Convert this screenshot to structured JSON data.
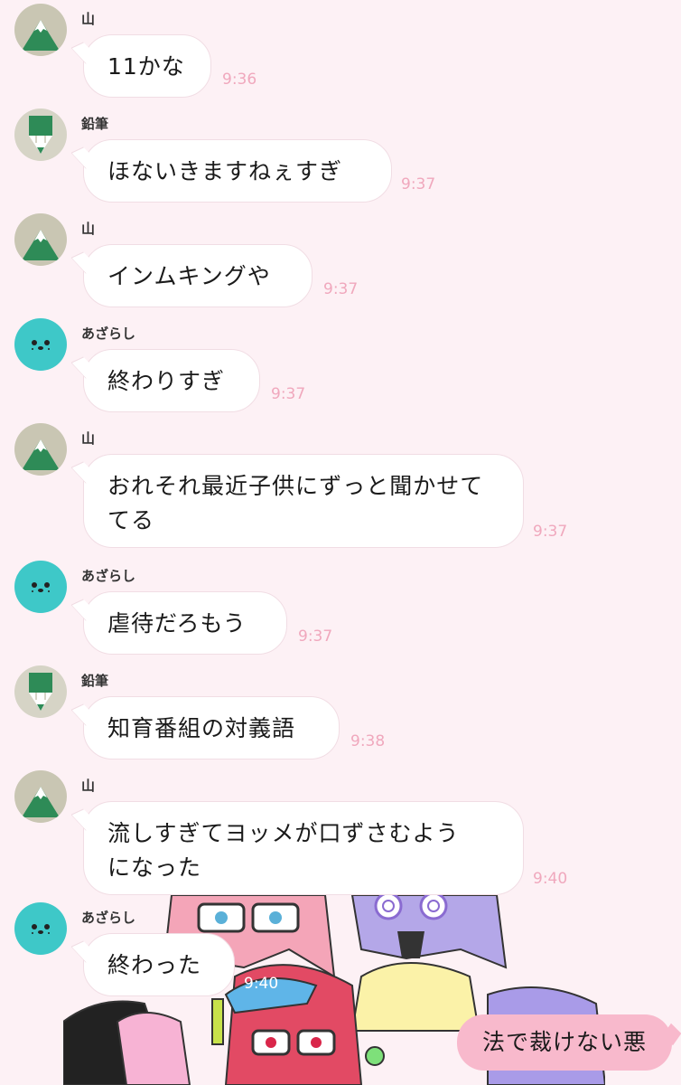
{
  "colors": {
    "background": "#fdf1f5",
    "bubble": "#ffffff",
    "outgoing_bubble": "#f8b9cc",
    "timestamp": "#f0a8bd",
    "mountain_green": "#2e8b57",
    "avatar_tan": "#c9c6b3",
    "seal_teal": "#3ec8c8"
  },
  "messages": [
    {
      "sender": "山",
      "avatar": "mountain-icon",
      "text": "11かな",
      "time": "9:36"
    },
    {
      "sender": "鉛筆",
      "avatar": "pencil-icon",
      "text": "ほないきますねぇすぎ",
      "time": "9:37"
    },
    {
      "sender": "山",
      "avatar": "mountain-icon",
      "text": "インムキングや",
      "time": "9:37"
    },
    {
      "sender": "あざらし",
      "avatar": "seal-icon",
      "text": "終わりすぎ",
      "time": "9:37"
    },
    {
      "sender": "山",
      "avatar": "mountain-icon",
      "text": "おれそれ最近子供にずっと聞かせて\nてる",
      "time": "9:37"
    },
    {
      "sender": "あざらし",
      "avatar": "seal-icon",
      "text": "虐待だろもう",
      "time": "9:37"
    },
    {
      "sender": "鉛筆",
      "avatar": "pencil-icon",
      "text": "知育番組の対義語",
      "time": "9:38"
    },
    {
      "sender": "山",
      "avatar": "mountain-icon",
      "text": "流しすぎてヨッメが口ずさむよう\nになった",
      "time": "9:40"
    },
    {
      "sender": "あざらし",
      "avatar": "seal-icon",
      "text": "終わった",
      "time": "9:40"
    }
  ],
  "outgoing": {
    "text": "法で裁けない悪"
  }
}
